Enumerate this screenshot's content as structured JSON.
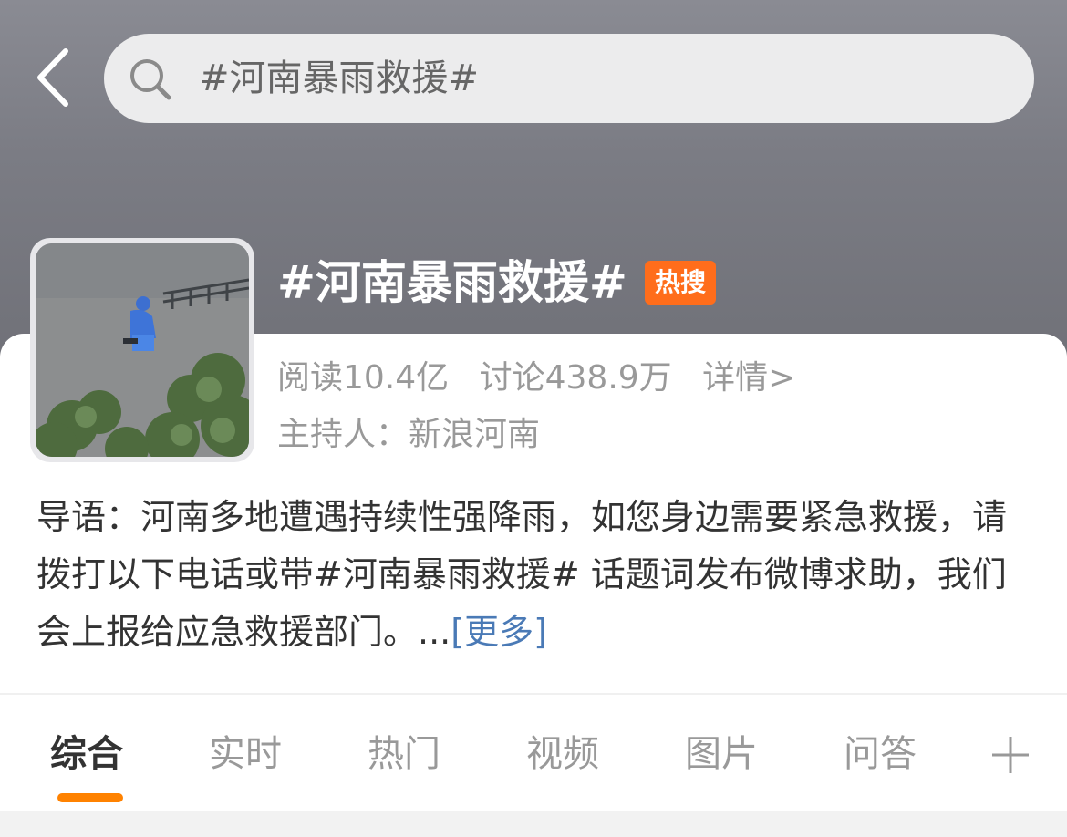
{
  "search": {
    "query": "#河南暴雨救援#"
  },
  "topic": {
    "title": "#河南暴雨救援#",
    "badge": "热搜",
    "reads": "阅读10.4亿",
    "discussions": "讨论438.9万",
    "details_link": "详情>",
    "host": "主持人：新浪河南",
    "intro": "导语：河南多地遭遇持续性强降雨，如您身边需要紧急救援，请拨打以下电话或带#河南暴雨救援# 话题词发布微博求助，我们会上报给应急救援部门。...",
    "more_link": "[更多]"
  },
  "tabs": [
    {
      "label": "综合"
    },
    {
      "label": "实时"
    },
    {
      "label": "热门"
    },
    {
      "label": "视频"
    },
    {
      "label": "图片"
    },
    {
      "label": "问答"
    }
  ],
  "icons": {
    "back": "chevron-left-icon",
    "search": "search-icon",
    "add_tab": "plus-icon"
  },
  "colors": {
    "accent": "#ff8200",
    "badge": "#ff6d1b",
    "link": "#4a7ab6"
  }
}
